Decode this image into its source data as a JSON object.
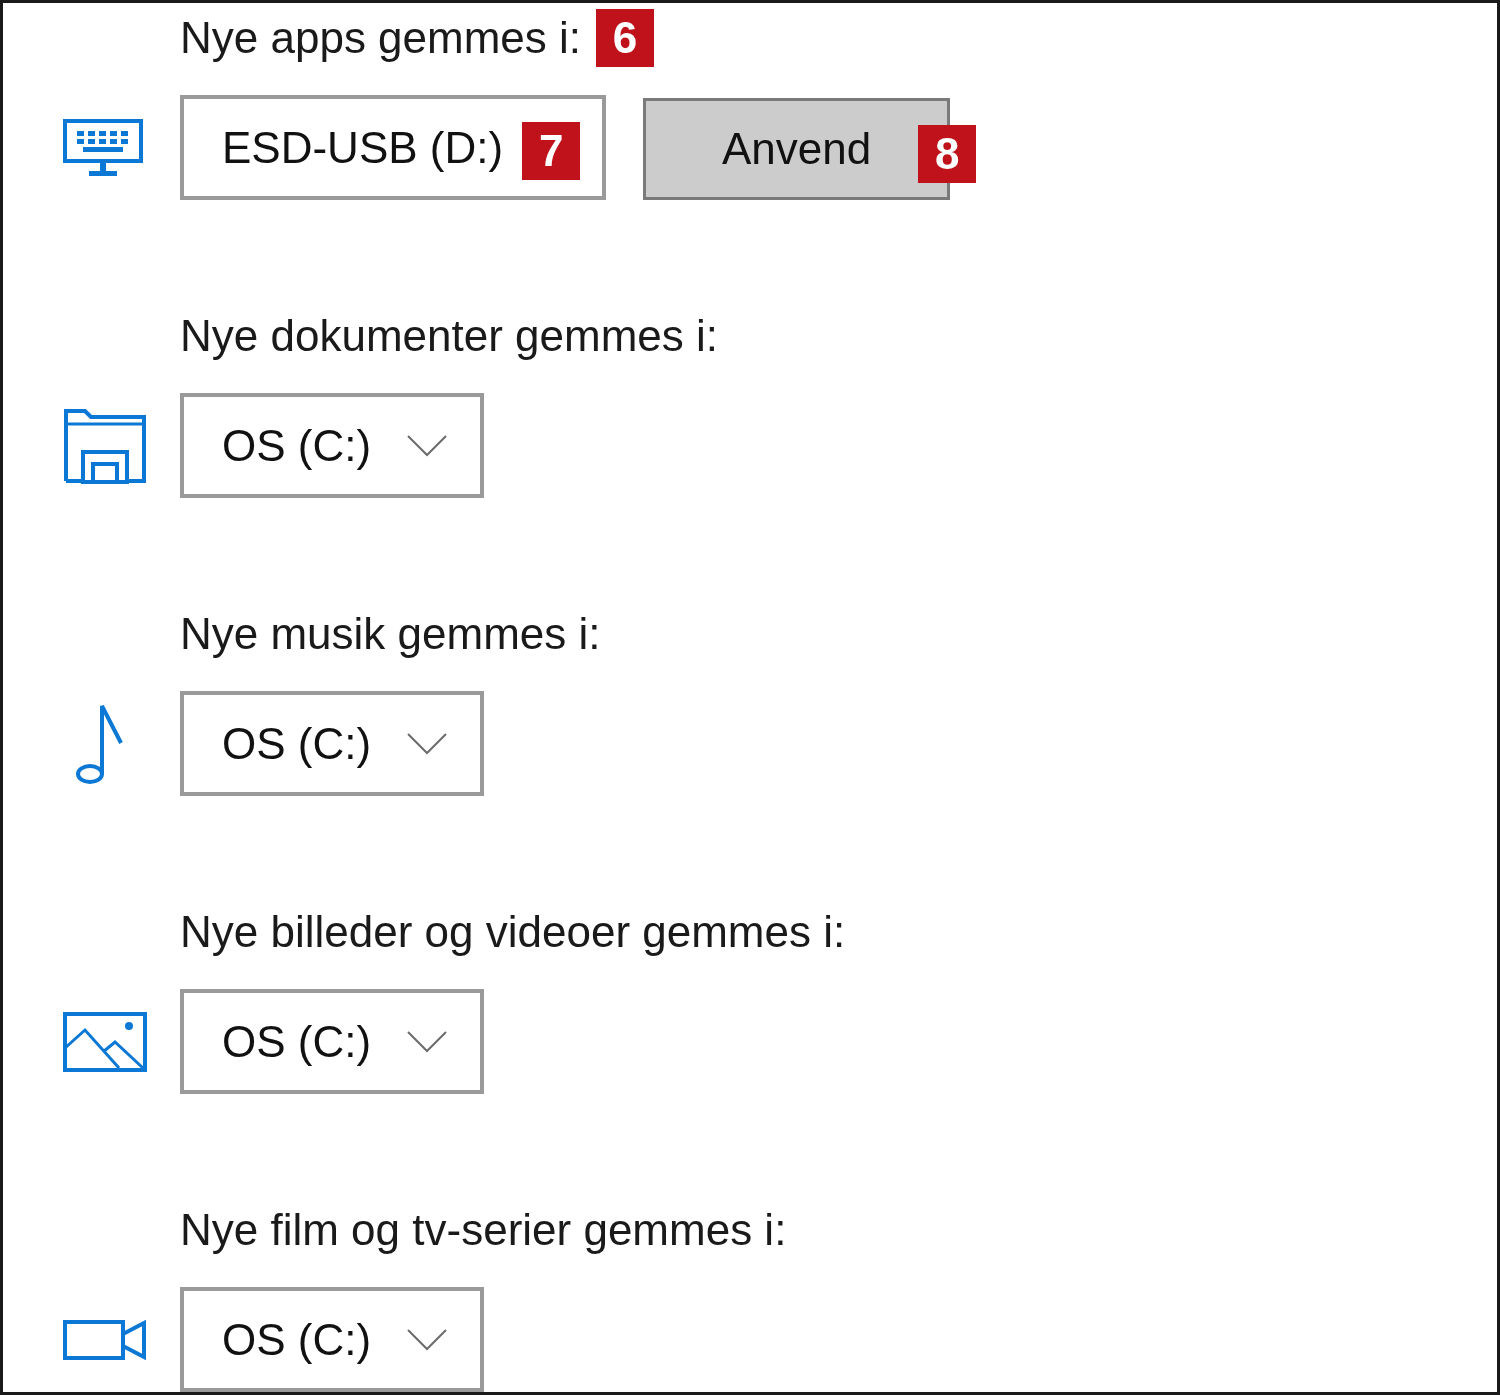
{
  "sections": [
    {
      "label": "Nye apps gemmes i:",
      "badge": "6",
      "dropdown": {
        "value": "ESD-USB (D:)",
        "badge": "7"
      },
      "button": {
        "label": "Anvend",
        "badge": "8"
      }
    },
    {
      "label": "Nye dokumenter gemmes i:",
      "dropdown": {
        "value": "OS (C:)"
      }
    },
    {
      "label": "Nye musik gemmes i:",
      "dropdown": {
        "value": "OS (C:)"
      }
    },
    {
      "label": "Nye billeder og videoer gemmes i:",
      "dropdown": {
        "value": "OS (C:)"
      }
    },
    {
      "label": "Nye film og tv-serier gemmes i:",
      "dropdown": {
        "value": "OS (C:)"
      }
    }
  ]
}
